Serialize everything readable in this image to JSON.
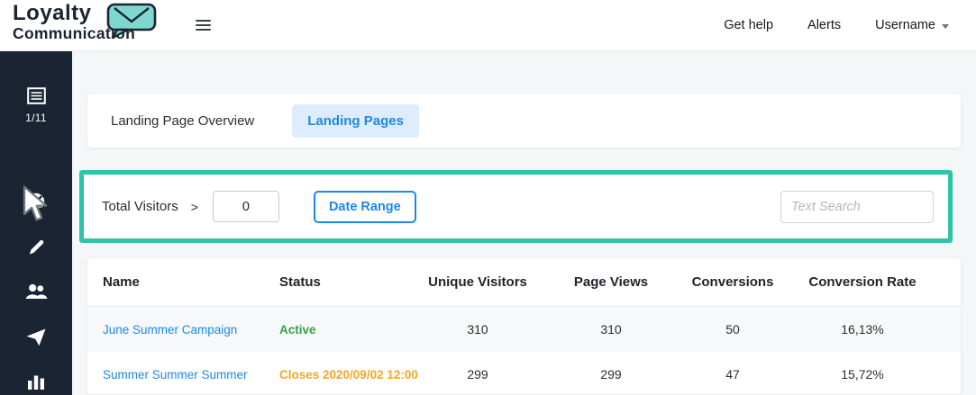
{
  "header": {
    "logo": {
      "line1": "Loyalty",
      "line2": "Communication"
    },
    "get_help": "Get help",
    "alerts": "Alerts",
    "username": "Username"
  },
  "sidebar": {
    "page_indicator": "1/11",
    "icons": [
      "pages-icon",
      "dashboard-icon",
      "edit-icon",
      "users-icon",
      "send-icon",
      "chart-icon"
    ]
  },
  "tabs": {
    "overview": "Landing Page Overview",
    "landing_pages": "Landing Pages"
  },
  "filters": {
    "total_visitors_label": "Total Visitors",
    "operator": ">",
    "visitors_value": "0",
    "date_range_label": "Date Range",
    "search_placeholder": "Text Search"
  },
  "table": {
    "columns": [
      "Name",
      "Status",
      "Unique Visitors",
      "Page Views",
      "Conversions",
      "Conversion Rate"
    ],
    "rows": [
      {
        "name": "June Summer Campaign",
        "status": "Active",
        "unique_visitors": "310",
        "page_views": "310",
        "conversions": "50",
        "conversion_rate": "16,13%"
      },
      {
        "name": "Summer Summer Summer",
        "status": "Closes 2020/09/02 12:00",
        "unique_visitors": "299",
        "page_views": "299",
        "conversions": "47",
        "conversion_rate": "15,72%"
      }
    ]
  },
  "colors": {
    "accent_teal": "#2ec4a8",
    "link_blue": "#1e88e5",
    "status_active_green": "#33a04c",
    "status_closing_orange": "#f5a623",
    "sidebar_navy": "#1a2433",
    "logo_bubble_teal": "#7fd8cf"
  }
}
